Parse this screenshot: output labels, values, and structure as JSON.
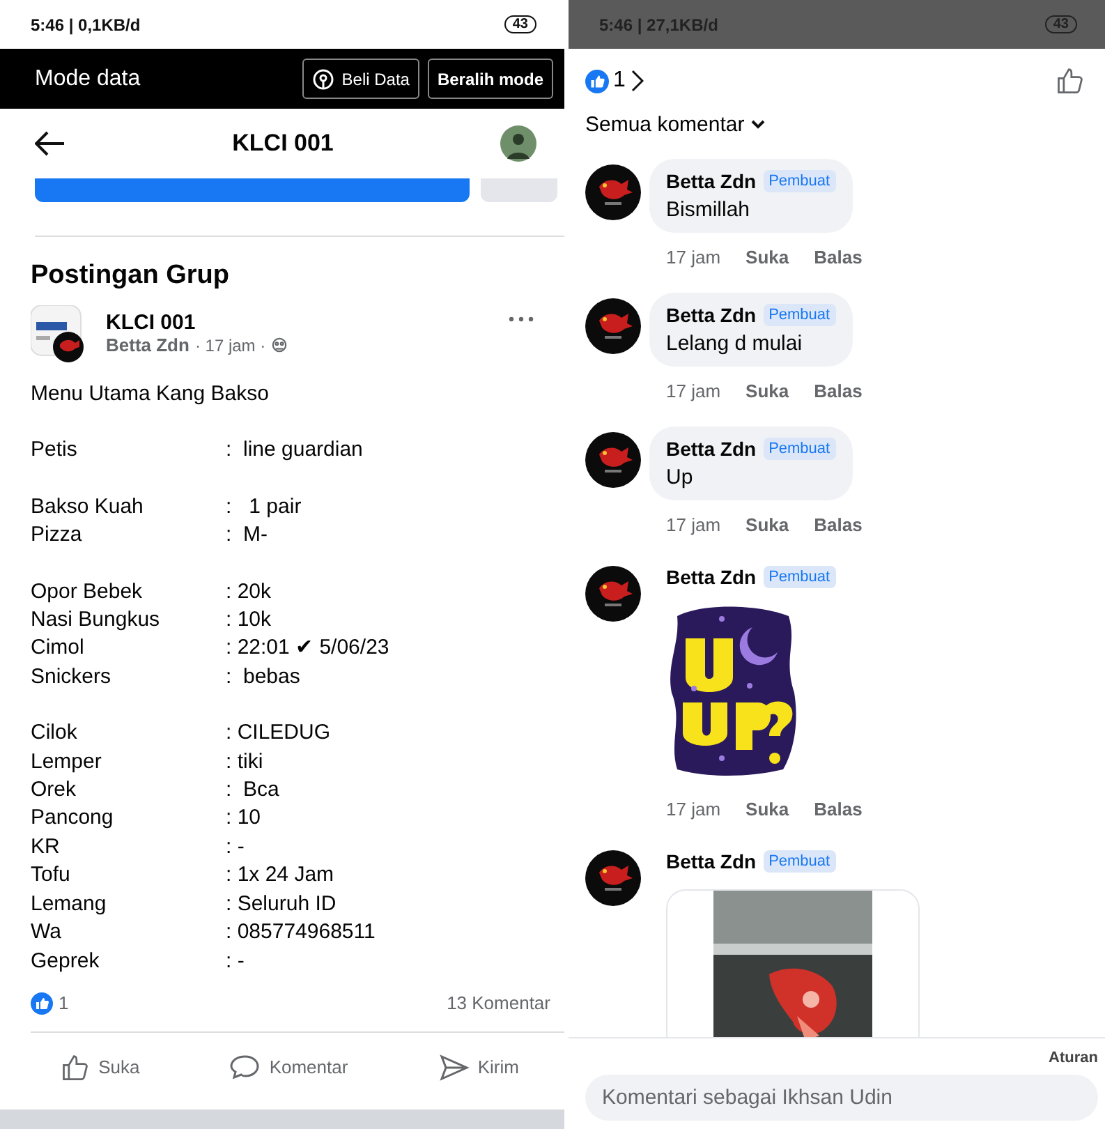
{
  "left_phone": {
    "status_bar": {
      "text": "5:46 | 0,1KB/d",
      "battery": "43"
    },
    "data_mode_bar": {
      "title": "Mode data",
      "buttons": [
        "Beli Data",
        "Beralih mode"
      ]
    },
    "header": {
      "title": "KLCI 001"
    },
    "section_title": "Postingan Grup",
    "post": {
      "group": "KLCI 001",
      "author": "Betta Zdn",
      "meta": "· 17 jam ·",
      "intro": "Menu Utama Kang Bakso",
      "groups": [
        [
          {
            "label": "Petis",
            "value": ":  line guardian"
          }
        ],
        [
          {
            "label": "Bakso Kuah",
            "value": ":   1 pair"
          },
          {
            "label": "Pizza",
            "value": ":  M-"
          }
        ],
        [
          {
            "label": "Opor Bebek",
            "value": ": 20k"
          },
          {
            "label": "Nasi Bungkus",
            "value": ": 10k"
          },
          {
            "label": "Cimol",
            "value": ": 22:01 ✔ 5/06/23"
          },
          {
            "label": "Snickers",
            "value": ":  bebas"
          }
        ],
        [
          {
            "label": "Cilok",
            "value": ": CILEDUG"
          },
          {
            "label": "Lemper",
            "value": ": tiki"
          },
          {
            "label": "Orek",
            "value": ":  Bca"
          },
          {
            "label": "Pancong",
            "value": ": 10"
          },
          {
            "label": "KR",
            "value": ": -"
          },
          {
            "label": "Tofu",
            "value": ": 1x 24 Jam"
          },
          {
            "label": "Lemang",
            "value": ": Seluruh ID"
          },
          {
            "label": "Wa",
            "value": ": 085774968511"
          },
          {
            "label": "Geprek",
            "value": ": -"
          }
        ]
      ],
      "reactions": "1",
      "comments": "13 Komentar",
      "actions": [
        "Suka",
        "Komentar",
        "Kirim"
      ]
    }
  },
  "right_phone": {
    "status_bar": {
      "text": "5:46 | 27,1KB/d",
      "battery": "43"
    },
    "reactions": "1",
    "filter": "Semua komentar",
    "comments": [
      {
        "kind": "text",
        "author": "Betta Zdn",
        "badge": "Pembuat",
        "text": "Bismillah",
        "time": "17 jam",
        "like": "Suka",
        "reply": "Balas"
      },
      {
        "kind": "text",
        "author": "Betta Zdn",
        "badge": "Pembuat",
        "text": "Lelang d mulai",
        "time": "17 jam",
        "like": "Suka",
        "reply": "Balas"
      },
      {
        "kind": "text",
        "author": "Betta Zdn",
        "badge": "Pembuat",
        "text": "Up",
        "time": "17 jam",
        "like": "Suka",
        "reply": "Balas"
      },
      {
        "kind": "sticker",
        "author": "Betta Zdn",
        "badge": "Pembuat",
        "time": "17 jam",
        "like": "Suka",
        "reply": "Balas"
      },
      {
        "author": "Betta Zdn",
        "badge": "Pembuat"
      }
    ],
    "rules_link": "Aturan",
    "input": {
      "placeholder": "Komentari sebagai Ikhsan Udin"
    }
  }
}
